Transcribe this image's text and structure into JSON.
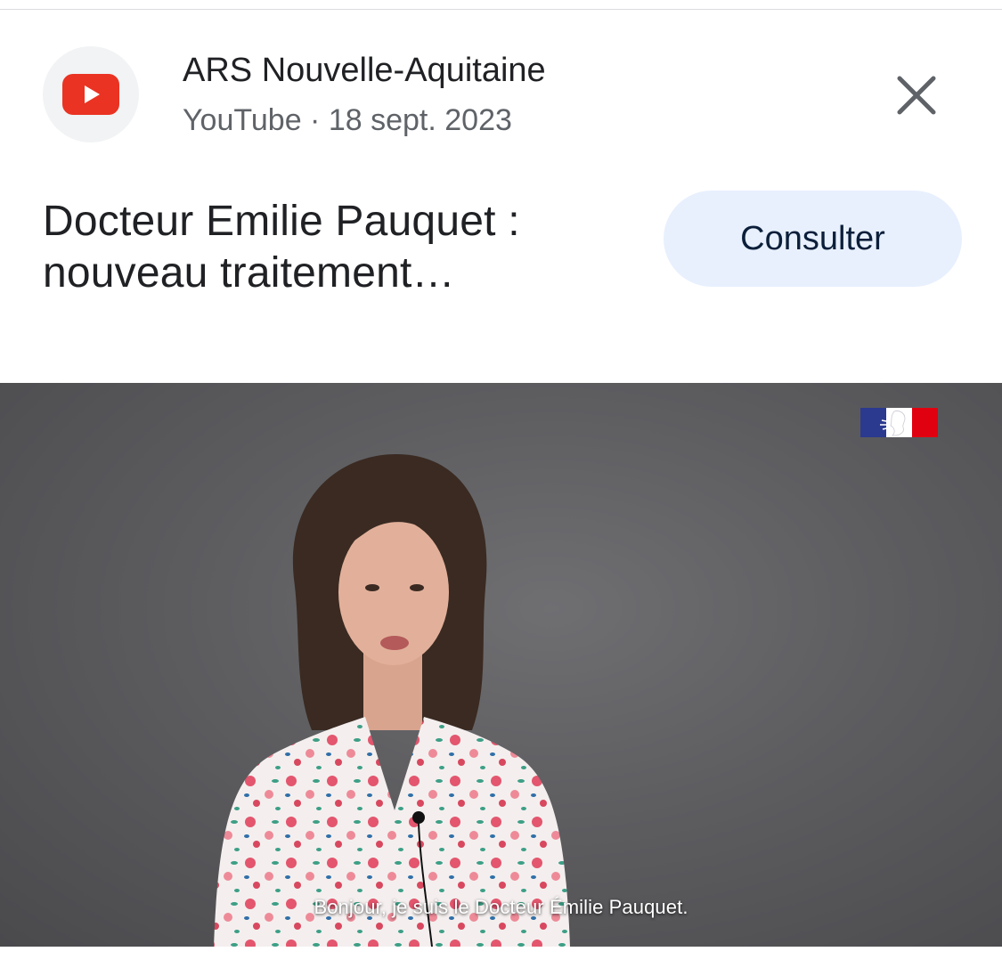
{
  "header": {
    "source_name": "ARS Nouvelle-Aquitaine",
    "platform": "YouTube",
    "separator": " · ",
    "date": "18 sept. 2023",
    "source_icon": "youtube-icon",
    "close_icon": "close-icon"
  },
  "result": {
    "title_line1": "Docteur Emilie Pauquet :",
    "title_line2": "nouveau traitement…",
    "action_label": "Consulter"
  },
  "video": {
    "caption": "Bonjour, je suis le Docteur Émilie Pauquet.",
    "logo_icon": "marianne-flag-icon"
  },
  "colors": {
    "youtube_red": "#ea3323",
    "button_bg": "#e8f0fe",
    "text_primary": "#202124",
    "text_secondary": "#5f6368"
  }
}
